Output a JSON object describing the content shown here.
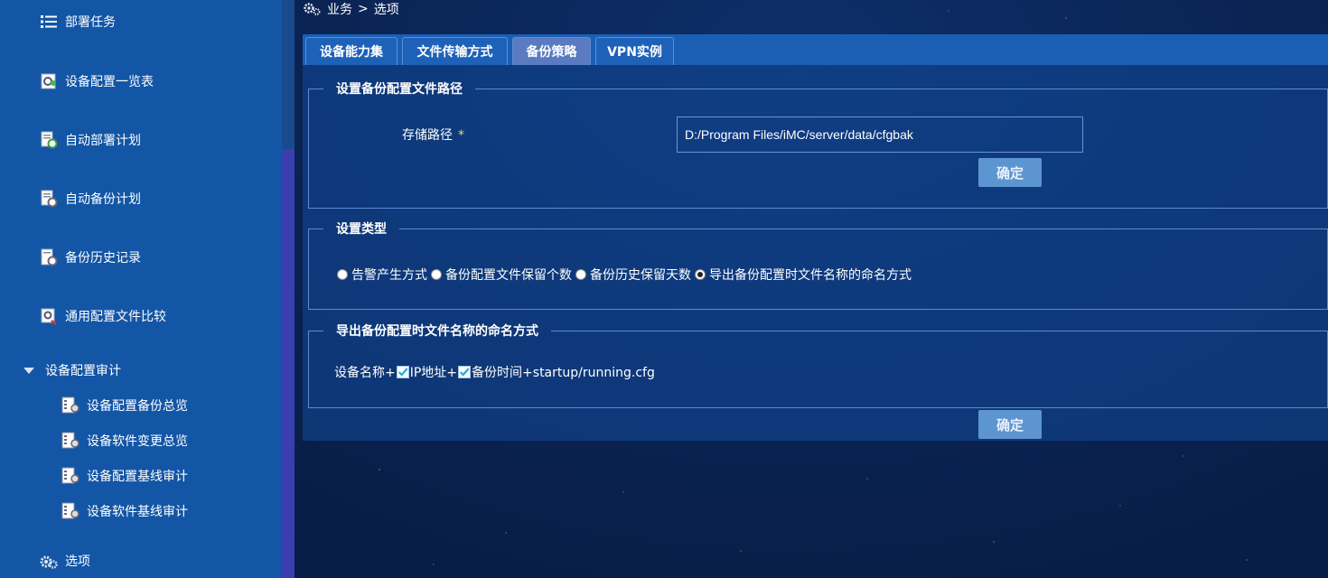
{
  "sidebar": {
    "items": [
      {
        "label": "部署任务",
        "icon": "list-icon"
      },
      {
        "label": "设备配置一览表",
        "icon": "device-config-icon"
      },
      {
        "label": "自动部署计划",
        "icon": "auto-deploy-icon"
      },
      {
        "label": "自动备份计划",
        "icon": "auto-backup-icon"
      },
      {
        "label": "备份历史记录",
        "icon": "backup-history-icon"
      },
      {
        "label": "通用配置文件比较",
        "icon": "compare-icon"
      }
    ],
    "group": {
      "label": "设备配置审计",
      "children": [
        {
          "label": "设备配置备份总览",
          "icon": "audit-report-icon"
        },
        {
          "label": "设备软件变更总览",
          "icon": "audit-report-icon"
        },
        {
          "label": "设备配置基线审计",
          "icon": "audit-report-icon"
        },
        {
          "label": "设备软件基线审计",
          "icon": "audit-report-icon"
        }
      ]
    },
    "bottom_item": {
      "label": "选项",
      "icon": "gears-icon"
    }
  },
  "breadcrumb": {
    "part1": "业务",
    "separator": ">",
    "part2": "选项"
  },
  "tabs": [
    {
      "label": "设备能力集",
      "active": false
    },
    {
      "label": "文件传输方式",
      "active": false
    },
    {
      "label": "备份策略",
      "active": true
    },
    {
      "label": "VPN实例",
      "active": false
    }
  ],
  "path_section": {
    "legend": "设置备份配置文件路径",
    "storage_label": "存储路径",
    "required_mark": "*",
    "storage_value": "D:/Program Files/iMC/server/data/cfgbak",
    "confirm_label": "确定"
  },
  "type_section": {
    "legend": "设置类型",
    "options": [
      {
        "label": "告警产生方式",
        "checked": false
      },
      {
        "label": "备份配置文件保留个数",
        "checked": false
      },
      {
        "label": "备份历史保留天数",
        "checked": false
      },
      {
        "label": "导出备份配置时文件名称的命名方式",
        "checked": true
      }
    ]
  },
  "naming_section": {
    "legend": "导出备份配置时文件名称的命名方式",
    "prefix": "设备名称+",
    "ip_label": "IP地址+",
    "time_label": "备份时间+startup/running.cfg",
    "confirm_label": "确定"
  },
  "colors": {
    "sidebar_bg": "#1356a6",
    "active_tab": "#5a7bc1",
    "button_bg": "#5d95d1",
    "required": "#ffd34d",
    "checkbox_tick": "#22b0d8"
  }
}
